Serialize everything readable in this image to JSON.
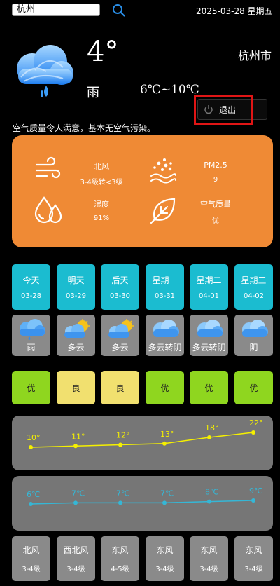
{
  "search": {
    "value": "杭州"
  },
  "date_line": "2025-03-28 星期五",
  "current": {
    "temp": "4°",
    "city": "杭州市",
    "desc": "雨",
    "range": "6℃~10℃"
  },
  "logout_label": "退出",
  "air_message": "空气质量令人满意，基本无空气污染。",
  "panel": {
    "wind_label": "北风",
    "wind_value": "3-4级转<3级",
    "pm_label": "PM2.5",
    "pm_value": "9",
    "humidity_label": "湿度",
    "humidity_value": "91%",
    "aqi_label": "空气质量",
    "aqi_value": "优"
  },
  "days": [
    {
      "name": "今天",
      "date": "03-28",
      "weather": "雨",
      "icon": "rain-cloud-icon",
      "aqi": "优",
      "aqi_color": "#8fd61f",
      "wind": "北风",
      "wind_level": "3-4级"
    },
    {
      "name": "明天",
      "date": "03-29",
      "weather": "多云",
      "icon": "partly-cloudy-icon",
      "aqi": "良",
      "aqi_color": "#f1e06f",
      "wind": "西北风",
      "wind_level": "3-4级"
    },
    {
      "name": "后天",
      "date": "03-30",
      "weather": "多云",
      "icon": "partly-cloudy-icon",
      "aqi": "良",
      "aqi_color": "#f1e06f",
      "wind": "东风",
      "wind_level": "4-5级"
    },
    {
      "name": "星期一",
      "date": "03-31",
      "weather": "多云转阴",
      "icon": "cloud-icon",
      "aqi": "优",
      "aqi_color": "#8fd61f",
      "wind": "东风",
      "wind_level": "3-4级"
    },
    {
      "name": "星期二",
      "date": "04-01",
      "weather": "多云转阴",
      "icon": "cloud-icon",
      "aqi": "优",
      "aqi_color": "#8fd61f",
      "wind": "东风",
      "wind_level": "3-4级"
    },
    {
      "name": "星期三",
      "date": "04-02",
      "weather": "阴",
      "icon": "cloud-icon",
      "aqi": "优",
      "aqi_color": "#8fd61f",
      "wind": "东风",
      "wind_level": "3-4级"
    }
  ],
  "chart_data": [
    {
      "type": "line",
      "series": [
        {
          "values": [
            10,
            11,
            12,
            13,
            18,
            22
          ]
        }
      ],
      "labels": [
        "10°",
        "11°",
        "12°",
        "13°",
        "18°",
        "22°"
      ],
      "color": "#f5f000"
    },
    {
      "type": "line",
      "series": [
        {
          "values": [
            6,
            7,
            7,
            7,
            8,
            9
          ]
        }
      ],
      "labels": [
        "6℃",
        "7℃",
        "7℃",
        "7℃",
        "8℃",
        "9℃"
      ],
      "color": "#35b7d6"
    }
  ],
  "colors": {
    "orange": "#ef8a35",
    "cyan": "#1bbcd0",
    "card_gray": "#8a8a8a",
    "chart_gray": "#767676",
    "highlight": "#e01515"
  }
}
